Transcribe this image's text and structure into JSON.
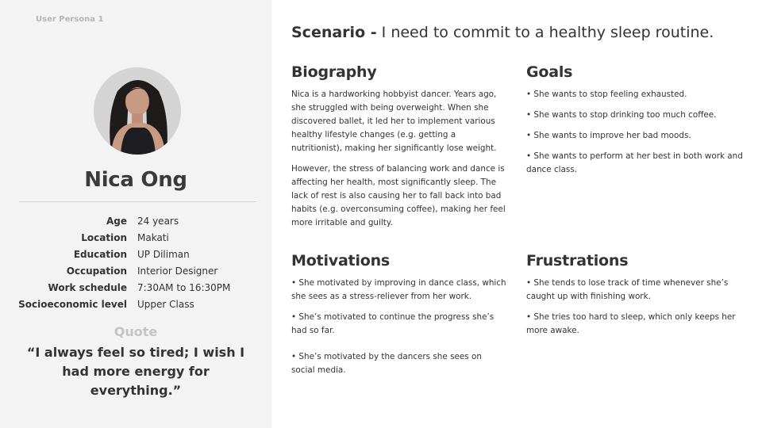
{
  "persona_label": "User Persona 1",
  "avatar": {
    "icon": "portrait-photo"
  },
  "name": "Nica Ong",
  "details": [
    {
      "label": "Age",
      "value": "24 years"
    },
    {
      "label": "Location",
      "value": "Makati"
    },
    {
      "label": "Education",
      "value": "UP Diliman"
    },
    {
      "label": "Occupation",
      "value": "Interior Designer"
    },
    {
      "label": "Work schedule",
      "value": "7:30AM to 16:30PM"
    },
    {
      "label": "Socioeconomic level",
      "value": "Upper Class"
    }
  ],
  "quote": {
    "label": "Quote",
    "text": "“I always feel so tired; I wish I had more energy for everything.”"
  },
  "scenario": {
    "label": "Scenario -",
    "text": "I need to commit to a healthy sleep routine."
  },
  "biography": {
    "title": "Biography",
    "paragraphs": [
      "Nica is a hardworking hobbyist dancer. Years ago, she struggled with being overweight. When she discovered ballet, it led her to implement various healthy lifestyle changes (e.g. getting a nutritionist), making her significantly lose weight.",
      "However, the stress of balancing work and dance is affecting her health, most significantly sleep. The lack of rest is also causing her to fall back into bad habits (e.g. overconsuming coffee), making her feel more irritable and guilty."
    ]
  },
  "goals": {
    "title": "Goals",
    "items": [
      "• She wants to stop feeling exhausted.",
      "• She wants to stop drinking too much coffee.",
      "• She wants to improve her bad moods.",
      "• She wants to perform at her best in both work and dance class."
    ]
  },
  "motivations": {
    "title": "Motivations",
    "items": [
      "• She motivated by improving in dance class, which she sees as a stress-reliever from her work.",
      "• She’s motivated to continue the progress she’s had so far.",
      "• She’s motivated by the dancers she sees on social media."
    ]
  },
  "frustrations": {
    "title": "Frustrations",
    "items": [
      "• She tends to lose track of time whenever she’s caught up with finishing work.",
      "• She tries too hard to sleep, which only keeps her more awake."
    ]
  },
  "colors": {
    "panel_bg": "#f3f3f3",
    "text": "#333333",
    "muted": "#c4c4c4"
  }
}
